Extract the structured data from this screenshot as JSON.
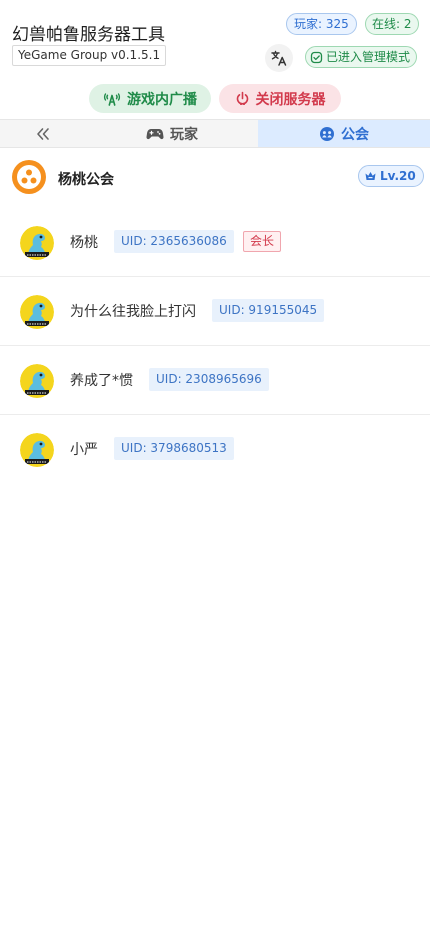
{
  "header": {
    "title": "幻兽帕鲁服务器工具",
    "version": "YeGame Group v0.1.5.1",
    "players_badge": "玩家: 325",
    "online_badge": "在线: 2",
    "admin_badge": "已进入管理模式",
    "translate_icon": "translate-icon"
  },
  "actions": {
    "broadcast_label": "游戏内广播",
    "shutdown_label": "关闭服务器"
  },
  "tabs": {
    "players_label": "玩家",
    "guild_label": "公会",
    "active": "guild"
  },
  "guild": {
    "name": "杨桃公会",
    "level": "Lv.20"
  },
  "members": [
    {
      "name": "杨桃",
      "uid": "UID: 2365636086",
      "role": "会长"
    },
    {
      "name": "为什么往我脸上打闪",
      "uid": "UID: 919155045",
      "role": ""
    },
    {
      "name": "养成了*惯",
      "uid": "UID: 2308965696",
      "role": ""
    },
    {
      "name": "小严",
      "uid": "UID: 3798680513",
      "role": ""
    }
  ],
  "colors": {
    "accent_blue": "#2f6fd1",
    "accent_green": "#1f8b49",
    "accent_red": "#d23a4c",
    "guild_orange": "#f5901e"
  }
}
